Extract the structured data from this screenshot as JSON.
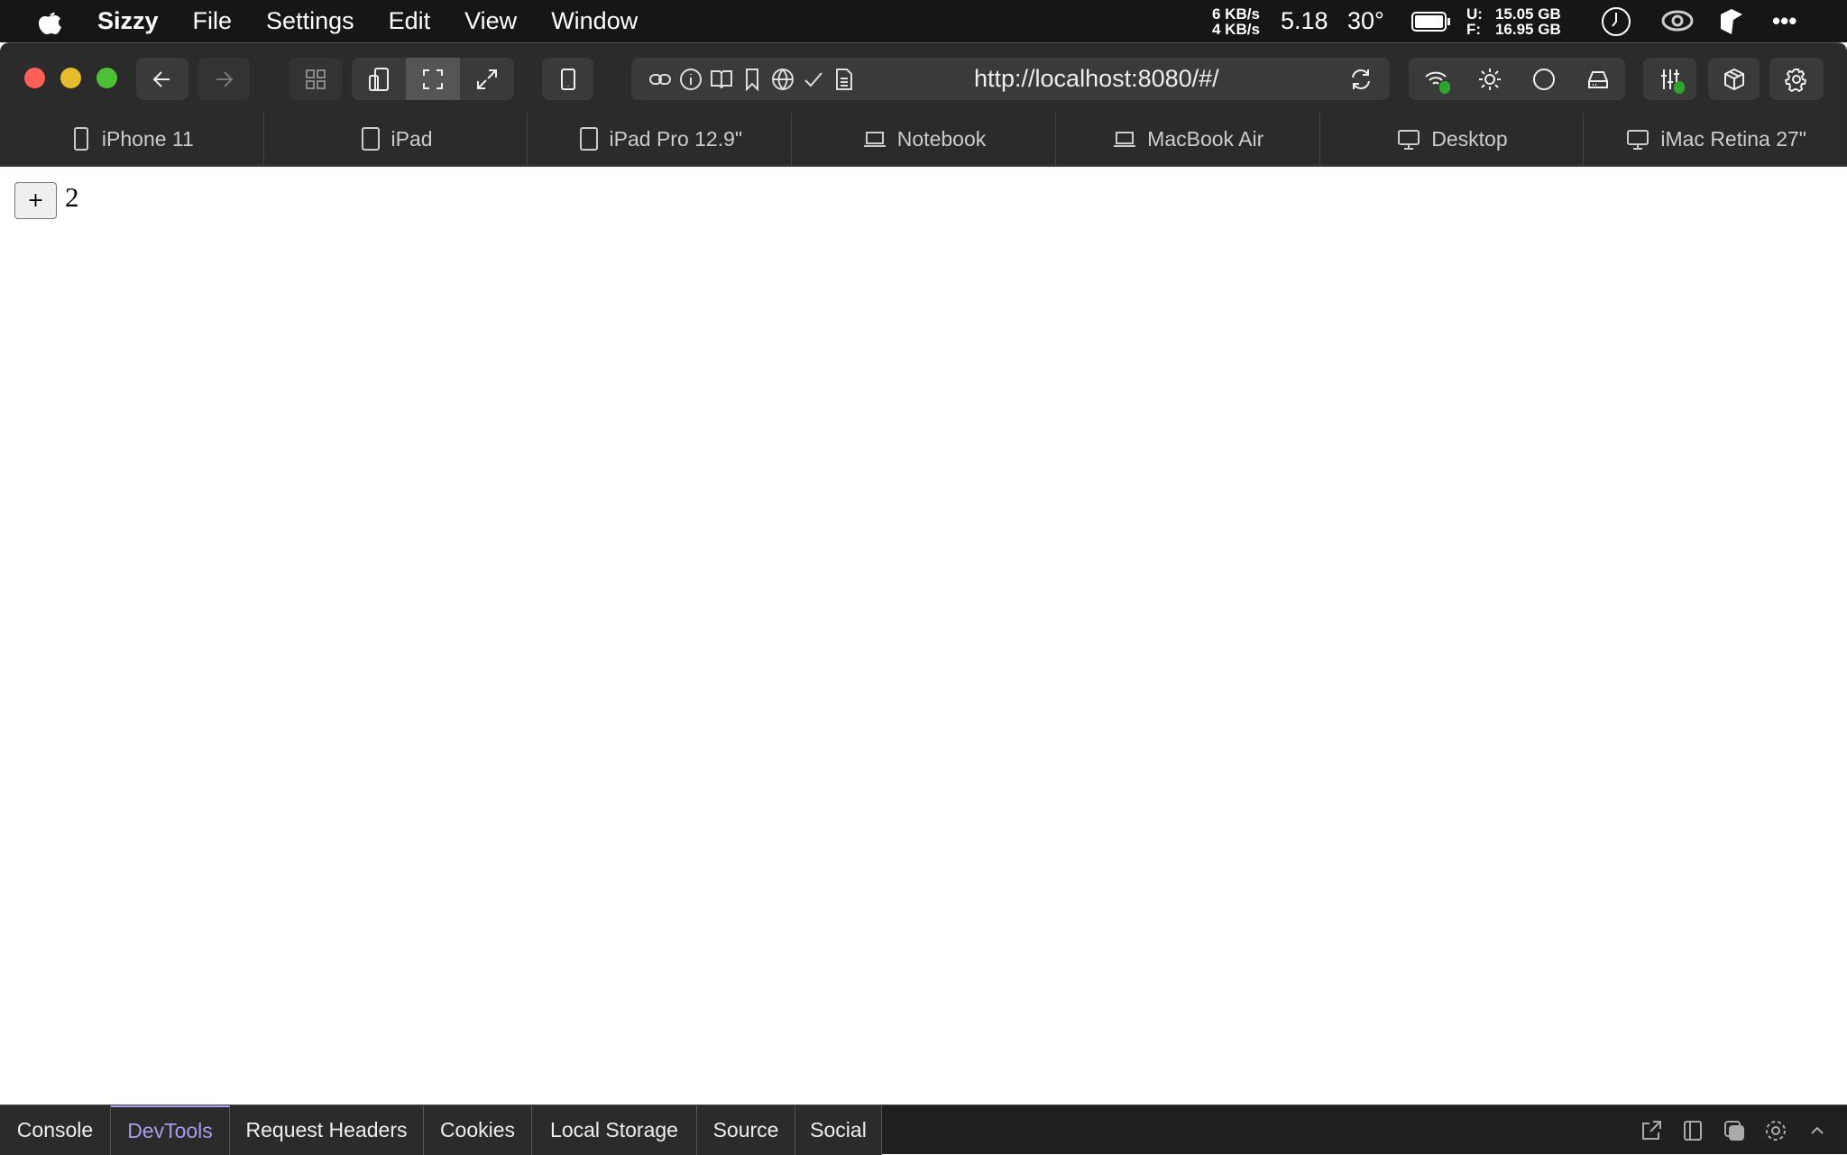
{
  "menubar": {
    "app": "Sizzy",
    "items": [
      "File",
      "Settings",
      "Edit",
      "View",
      "Window"
    ],
    "net_up": "6 KB/s",
    "net_down": "4 KB/s",
    "load": "5.18",
    "temp": "30°",
    "mem_used_label": "U:",
    "mem_used": "15.05 GB",
    "mem_free_label": "F:",
    "mem_free": "16.95 GB"
  },
  "toolbar": {
    "url": "http://localhost:8080/#/"
  },
  "devices": [
    {
      "label": "iPhone 11",
      "icon": "phone"
    },
    {
      "label": "iPad",
      "icon": "tablet"
    },
    {
      "label": "iPad Pro 12.9\"",
      "icon": "tablet"
    },
    {
      "label": "Notebook",
      "icon": "laptop"
    },
    {
      "label": "MacBook Air",
      "icon": "laptop"
    },
    {
      "label": "Desktop",
      "icon": "monitor"
    },
    {
      "label": "iMac Retina 27\"",
      "icon": "monitor"
    }
  ],
  "content": {
    "button_label": "+",
    "count": "2"
  },
  "bottom_tabs": [
    "Console",
    "DevTools",
    "Request Headers",
    "Cookies",
    "Local Storage",
    "Source",
    "Social"
  ],
  "active_bottom_tab": "DevTools",
  "colors": {
    "accent": "#a99be8",
    "status_green": "#2fa52f",
    "close": "#fe5f57",
    "minimize": "#e6bd2d",
    "maximize": "#4cc135"
  }
}
